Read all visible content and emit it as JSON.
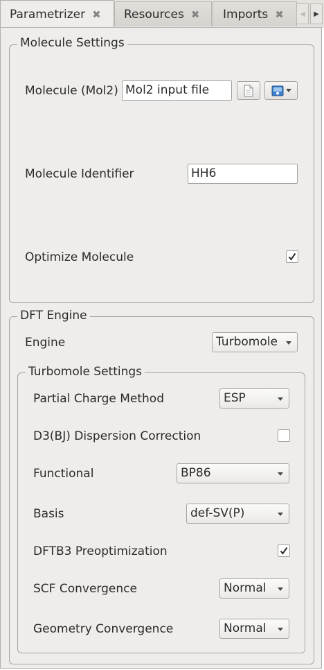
{
  "tabs": [
    {
      "label": "Parametrizer",
      "close": "✖"
    },
    {
      "label": "Resources",
      "close": "✖"
    },
    {
      "label": "Imports",
      "close": "✖"
    }
  ],
  "tab_scroll": {
    "left": "◀",
    "right": "▶"
  },
  "molecule_settings": {
    "title": "Molecule Settings",
    "molecule_label": "Molecule (Mol2)",
    "molecule_value": "Mol2 input file",
    "identifier_label": "Molecule Identifier",
    "identifier_value": "HH6",
    "optimize_label": "Optimize Molecule",
    "optimize_checked": true
  },
  "dft_engine": {
    "title": "DFT Engine",
    "engine_label": "Engine",
    "engine_value": "Turbomole"
  },
  "turbomole_settings": {
    "title": "Turbomole Settings",
    "partial_charge_label": "Partial Charge Method",
    "partial_charge_value": "ESP",
    "d3bj_label": "D3(BJ) Dispersion Correction",
    "d3bj_checked": false,
    "functional_label": "Functional",
    "functional_value": "BP86",
    "basis_label": "Basis",
    "basis_value": "def-SV(P)",
    "dftb3_label": "DFTB3 Preoptimization",
    "dftb3_checked": true,
    "scf_label": "SCF Convergence",
    "scf_value": "Normal",
    "geometry_label": "Geometry Convergence",
    "geometry_value": "Normal"
  },
  "icons": {
    "file": "document-icon",
    "database": "database-icon",
    "check": "checkmark-icon"
  },
  "colors": {
    "panel_bg": "#efedeb",
    "tabbar_bg": "#e4e1de",
    "database_blue": "#3d7fc8"
  }
}
